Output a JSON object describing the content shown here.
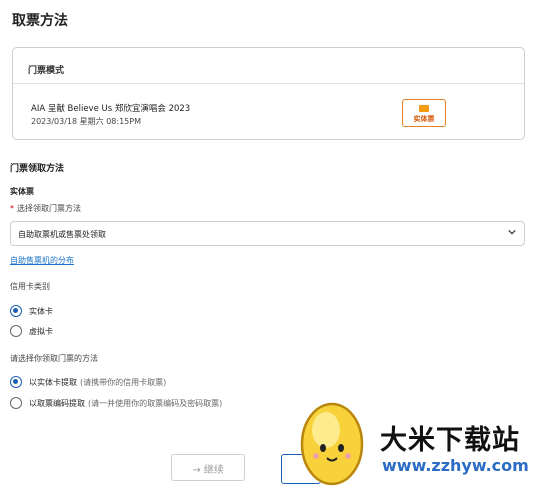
{
  "page": {
    "title": "取票方法"
  },
  "ticket_mode": {
    "header": "门票模式",
    "event_name": "AIA 呈献 Believe Us 郑欣宜演唱会 2023",
    "event_datetime": "2023/03/18 星期六 08:15PM",
    "ticket_type_label": "实体票",
    "accent_color": "#e67e22"
  },
  "collection": {
    "section_title": "门票领取方法",
    "sub_title": "实体票",
    "required_mark": "*",
    "field_label": "选择领取门票方法",
    "select_value": "自助取票机或售票处领取",
    "distribution_link": "自助售票机的分布"
  },
  "credit_card": {
    "label": "信用卡类别",
    "options": [
      {
        "label": "实体卡",
        "checked": true
      },
      {
        "label": "虚拟卡",
        "checked": false
      }
    ]
  },
  "collect_method": {
    "label": "请选择你领取门票的方法",
    "options": [
      {
        "label": "以实体卡提取",
        "note": "(请携带你的信用卡取票)",
        "checked": true
      },
      {
        "label": "以取票编码提取",
        "note": "(请一并使用你的取票编码及密码取票)",
        "checked": false
      }
    ]
  },
  "actions": {
    "continue_label": "→ 继续"
  },
  "watermark": {
    "title": "大米下载站",
    "url": "www.zzhyw.com",
    "url_color": "#2b6cc4"
  }
}
